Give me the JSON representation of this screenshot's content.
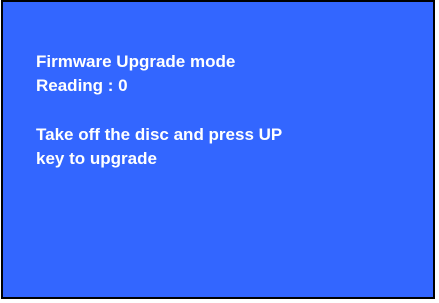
{
  "colors": {
    "screen_background": "#3366ff",
    "text": "#ffffff",
    "border": "#000000"
  },
  "screen": {
    "title": "Firmware Upgrade mode",
    "reading": "Reading : 0",
    "instruction_line1": "Take off the disc and press UP",
    "instruction_line2": "key to upgrade"
  }
}
